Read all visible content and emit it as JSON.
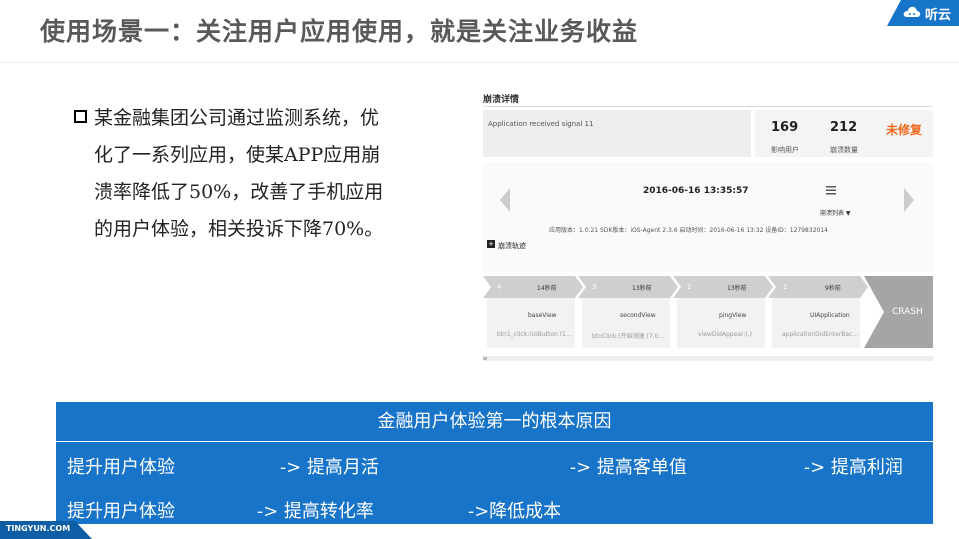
{
  "slide": {
    "title": "使用场景一：关注用户应用使用，就是关注业务收益",
    "logo": "听云",
    "footer": "TINGYUN.COM",
    "paragraph": [
      "某金融集团公司通过监测系统，优",
      "化了一系列应用，使某APP应用崩",
      "溃率降低了50%，改善了手机应用",
      "的用户体验，相关投诉下降70%。"
    ]
  },
  "crash_panel": {
    "title": "崩溃详情",
    "signal": "Application received signal 11",
    "stats": [
      {
        "value": "169",
        "label": "影响用户"
      },
      {
        "value": "212",
        "label": "崩溃数量"
      }
    ],
    "status": "未修复",
    "timestamp": "2016-06-16 13:35:57",
    "list_label": "崩溃列表 ▼",
    "meta": "应用版本：1.0.21  SDK版本：iOS-Agent 2.3.6  启动时间：2016-06-16 13:32  设备ID：1279832014",
    "trail_label": "崩溃轨迹",
    "steps": [
      {
        "num": "4",
        "time": "14秒前",
        "view": "baseView",
        "action": "btn1_click:(UIButton (1..."
      },
      {
        "num": "3",
        "time": "13秒前",
        "view": "secondView",
        "action": "btnClick:(开始测速 (7.0..."
      },
      {
        "num": "2",
        "time": "13秒前",
        "view": "pingView",
        "action": "viewDidAppear:(,)"
      },
      {
        "num": "1",
        "time": "9秒前",
        "view": "UIApplication",
        "action": "applicationDidEnterBac..."
      }
    ],
    "crash": "CRASH"
  },
  "summary": {
    "heading": "金融用户体验第一的根本原因",
    "row1": [
      "提升用户体验",
      "-> 提高月活",
      "-> 提高客单值",
      "-> 提高利润"
    ],
    "row2": [
      "提升用户体验",
      "-> 提高转化率",
      "->降低成本"
    ]
  },
  "colors": {
    "accent": "#1874c8",
    "status": "#f06a1f"
  }
}
